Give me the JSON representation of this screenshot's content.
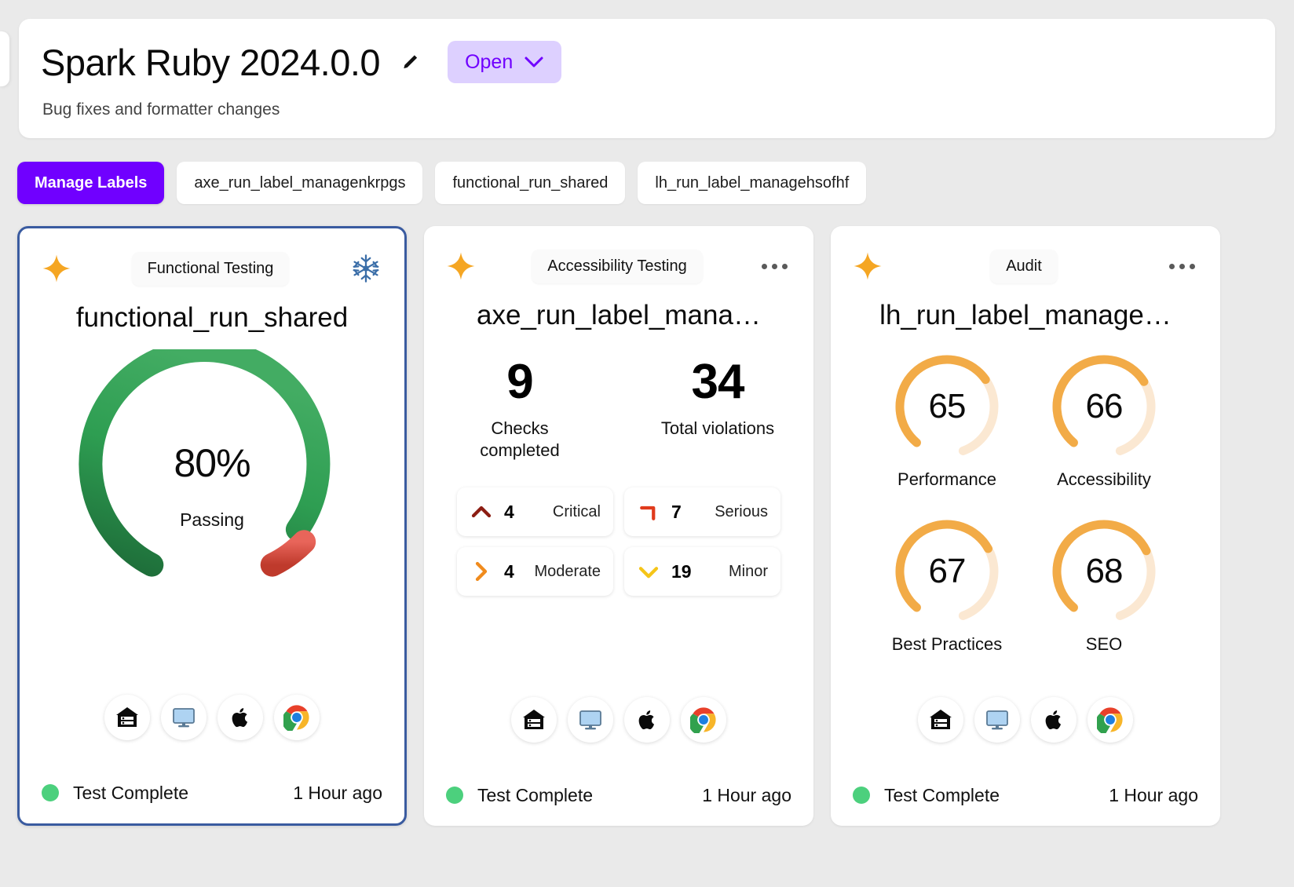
{
  "header": {
    "title": "Spark Ruby 2024.0.0",
    "edit_icon": "pencil-icon",
    "status": "Open",
    "status_chevron": "chevron-down-icon",
    "subtitle": "Bug fixes and formatter changes",
    "accent": "#7000ff",
    "status_bg": "#ddd0ff"
  },
  "labels": {
    "manage_button": "Manage Labels",
    "chips": [
      "axe_run_label_managenkrpgs",
      "functional_run_shared",
      "lh_run_label_managehsofhf"
    ]
  },
  "cards": [
    {
      "kind": "functional",
      "selected": true,
      "sparkle_icon": "sparkle-icon",
      "badge": "Functional Testing",
      "corner_icon": "snowflake-icon",
      "title": "functional_run_shared",
      "gauge": {
        "percent": "80%",
        "value": 80,
        "label": "Passing",
        "pass_color": "#2e9e52",
        "pass_color_dark": "#1d6b38",
        "fail_color": "#e8655a",
        "fail_color_dark": "#c0392b"
      },
      "platforms": [
        "server-icon",
        "desktop-monitor-icon",
        "apple-icon",
        "chrome-icon"
      ],
      "status": "Test Complete",
      "status_color": "#4cd07d",
      "time": "1 Hour ago"
    },
    {
      "kind": "accessibility",
      "selected": false,
      "sparkle_icon": "sparkle-icon",
      "badge": "Accessibility Testing",
      "corner_icon": "more-options-icon",
      "title": "axe_run_label_mana…",
      "stats": [
        {
          "value": "9",
          "label": "Checks completed"
        },
        {
          "value": "34",
          "label": "Total violations"
        }
      ],
      "severities": [
        {
          "icon": "chevron-up-icon",
          "count": "4",
          "label": "Critical",
          "color": "#8c1d12"
        },
        {
          "icon": "chevron-corner-icon",
          "count": "7",
          "label": "Serious",
          "color": "#e03b1c"
        },
        {
          "icon": "chevron-right-icon",
          "count": "4",
          "label": "Moderate",
          "color": "#f08b1d"
        },
        {
          "icon": "chevron-down-icon",
          "count": "19",
          "label": "Minor",
          "color": "#f5c518"
        }
      ],
      "platforms": [
        "server-icon",
        "desktop-monitor-icon",
        "apple-icon",
        "chrome-icon"
      ],
      "status": "Test Complete",
      "status_color": "#4cd07d",
      "time": "1 Hour ago"
    },
    {
      "kind": "audit",
      "selected": false,
      "sparkle_icon": "sparkle-icon",
      "badge": "Audit",
      "corner_icon": "more-options-icon",
      "title": "lh_run_label_manage…",
      "scores": [
        {
          "value": "65",
          "num": 65,
          "label": "Performance"
        },
        {
          "value": "66",
          "num": 66,
          "label": "Accessibility"
        },
        {
          "value": "67",
          "num": 67,
          "label": "Best Practices"
        },
        {
          "value": "68",
          "num": 68,
          "label": "SEO"
        }
      ],
      "score_color": "#f2ab47",
      "score_track": "#fbe8d2",
      "platforms": [
        "server-icon",
        "desktop-monitor-icon",
        "apple-icon",
        "chrome-icon"
      ],
      "status": "Test Complete",
      "status_color": "#4cd07d",
      "time": "1 Hour ago"
    }
  ]
}
